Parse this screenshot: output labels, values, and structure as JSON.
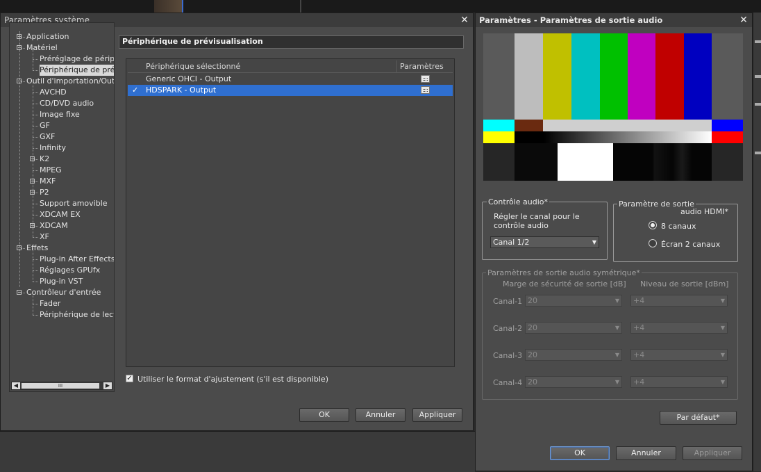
{
  "sys_window": {
    "title": "Paramètres système",
    "tree": [
      {
        "label": "Application",
        "level": 0,
        "expander": "+"
      },
      {
        "label": "Matériel",
        "level": 0,
        "expander": "-"
      },
      {
        "label": "Préréglage de périphé",
        "level": 1
      },
      {
        "label": "Périphérique de prévis",
        "level": 1,
        "selected": true
      },
      {
        "label": "Outil d'importation/Outil d'",
        "level": 0,
        "expander": "-"
      },
      {
        "label": "AVCHD",
        "level": 1
      },
      {
        "label": "CD/DVD audio",
        "level": 1
      },
      {
        "label": "Image fixe",
        "level": 1
      },
      {
        "label": "GF",
        "level": 1
      },
      {
        "label": "GXF",
        "level": 1
      },
      {
        "label": "Infinity",
        "level": 1
      },
      {
        "label": "K2",
        "level": 1,
        "expander": "+"
      },
      {
        "label": "MPEG",
        "level": 1
      },
      {
        "label": "MXF",
        "level": 1,
        "expander": "+"
      },
      {
        "label": "P2",
        "level": 1,
        "expander": "+"
      },
      {
        "label": "Support amovible",
        "level": 1
      },
      {
        "label": "XDCAM EX",
        "level": 1
      },
      {
        "label": "XDCAM",
        "level": 1,
        "expander": "+"
      },
      {
        "label": "XF",
        "level": 1
      },
      {
        "label": "Effets",
        "level": 0,
        "expander": "-"
      },
      {
        "label": "Plug-in After Effects",
        "level": 1
      },
      {
        "label": "Réglages GPUfx",
        "level": 1
      },
      {
        "label": "Plug-in VST",
        "level": 1
      },
      {
        "label": "Contrôleur d'entrée",
        "level": 0,
        "expander": "-"
      },
      {
        "label": "Fader",
        "level": 1
      },
      {
        "label": "Périphérique de lectur",
        "level": 1
      }
    ],
    "scroll_thumb_label": "III",
    "section_title": "Périphérique de prévisualisation",
    "columns": {
      "selected_device": "Périphérique sélectionné",
      "params": "Paramètres"
    },
    "devices": [
      {
        "name": "Generic OHCI - Output",
        "checked": false,
        "selected": false
      },
      {
        "name": "HDSPARK - Output",
        "checked": true,
        "selected": true
      }
    ],
    "use_adjust_format": "Utiliser le format d'ajustement (s'il est disponible)",
    "buttons": {
      "ok": "OK",
      "cancel": "Annuler",
      "apply": "Appliquer"
    }
  },
  "audio_window": {
    "title": "Paramètres - Paramètres de sortie audio",
    "audio_control": {
      "group_label": "Contrôle audio*",
      "desc_line1": "Régler le canal pour le",
      "desc_line2": "contrôle audio",
      "channel_value": "Canal 1/2"
    },
    "output_param": {
      "group_label": "Paramètre de sortie",
      "sub_label": "audio HDMI*",
      "option_8ch": "8 canaux",
      "option_2ch": "Écran 2 canaux",
      "selected": "8 canaux"
    },
    "symmetric": {
      "group_label": "Paramètres de sortie audio symétrique*",
      "col_margin": "Marge de sécurité de sortie [dB]",
      "col_level": "Niveau de sortie [dBm]",
      "channels": [
        {
          "label": "Canal-1",
          "margin": "20",
          "level": "+4"
        },
        {
          "label": "Canal-2",
          "margin": "20",
          "level": "+4"
        },
        {
          "label": "Canal-3",
          "margin": "20",
          "level": "+4"
        },
        {
          "label": "Canal-4",
          "margin": "20",
          "level": "+4"
        }
      ]
    },
    "buttons": {
      "default": "Par défaut*",
      "ok": "OK",
      "cancel": "Annuler",
      "apply": "Appliquer"
    }
  },
  "colors": {
    "selection_blue": "#2f6fd0",
    "color_bars": [
      "#bdbdbd",
      "#c0c000",
      "#00c0c0",
      "#00c000",
      "#c000c0",
      "#c00000",
      "#0000c0"
    ]
  }
}
